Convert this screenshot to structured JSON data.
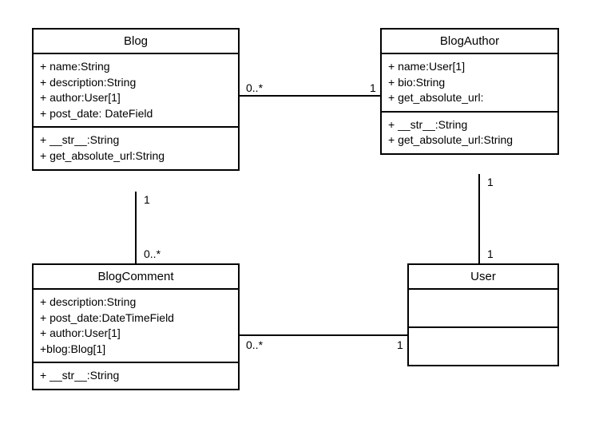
{
  "classes": {
    "blog": {
      "name": "Blog",
      "attributes": [
        "+ name:String",
        "+ description:String",
        "+ author:User[1]",
        "+ post_date: DateField"
      ],
      "methods": [
        "+ __str__:String",
        "+ get_absolute_url:String"
      ]
    },
    "blogAuthor": {
      "name": "BlogAuthor",
      "attributes": [
        "+ name:User[1]",
        "+ bio:String",
        "+ get_absolute_url:"
      ],
      "methods": [
        "+ __str__:String",
        "+ get_absolute_url:String"
      ]
    },
    "blogComment": {
      "name": "BlogComment",
      "attributes": [
        "+ description:String",
        "+ post_date:DateTimeField",
        "+ author:User[1]",
        "+blog:Blog[1]"
      ],
      "methods": [
        "+ __str__:String"
      ]
    },
    "user": {
      "name": "User",
      "attributes": [],
      "methods": []
    }
  },
  "associations": {
    "blog_blogauthor": {
      "leftMult": "0..*",
      "rightMult": "1"
    },
    "blog_blogcomment": {
      "topMult": "1",
      "bottomMult": "0..*"
    },
    "blogauthor_user": {
      "topMult": "1",
      "bottomMult": "1"
    },
    "blogcomment_user": {
      "leftMult": "0..*",
      "rightMult": "1"
    }
  }
}
